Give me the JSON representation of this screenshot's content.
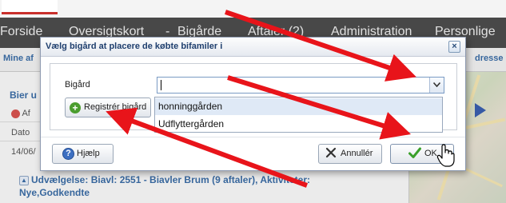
{
  "nav": {
    "items": [
      "Forside",
      "Oversigtskort",
      "Bigårde",
      "Aftaler (2)",
      "Administration",
      "Personlige"
    ],
    "dropdown_marker": "-"
  },
  "subnav": {
    "left_text": "Mine af",
    "right_text": "dresse"
  },
  "background_panel": {
    "title": "Bier u",
    "button_text": "Af",
    "col_header": "Dato",
    "row_value": "14/06/",
    "footer_text": "Udvælgelse: Biavl: 2551 - Biavler Brum (9 aftaler), Aktiviteter:",
    "footer_text_2": "Nye,Godkendte"
  },
  "dialog": {
    "title": "Vælg bigård at placere de købte bifamiler i",
    "close_label": "×",
    "field_label": "Bigård",
    "field_value": "",
    "register_button": "Registrér bigård",
    "dropdown_options": [
      "honninggården",
      "Udflyttergården"
    ],
    "help_button": "Hjælp",
    "cancel_button": "Annullér",
    "ok_button": "OK"
  },
  "colors": {
    "arrow_red": "#e8141a",
    "nav_bg": "#4d4d4d",
    "link_blue": "#3c6ea7",
    "ok_green": "#3aa02b"
  },
  "icons": [
    "plus-circle-icon",
    "help-icon",
    "cancel-x-icon",
    "checkmark-icon",
    "chevron-down-icon",
    "close-icon",
    "hand-cursor-icon",
    "play-icon"
  ]
}
